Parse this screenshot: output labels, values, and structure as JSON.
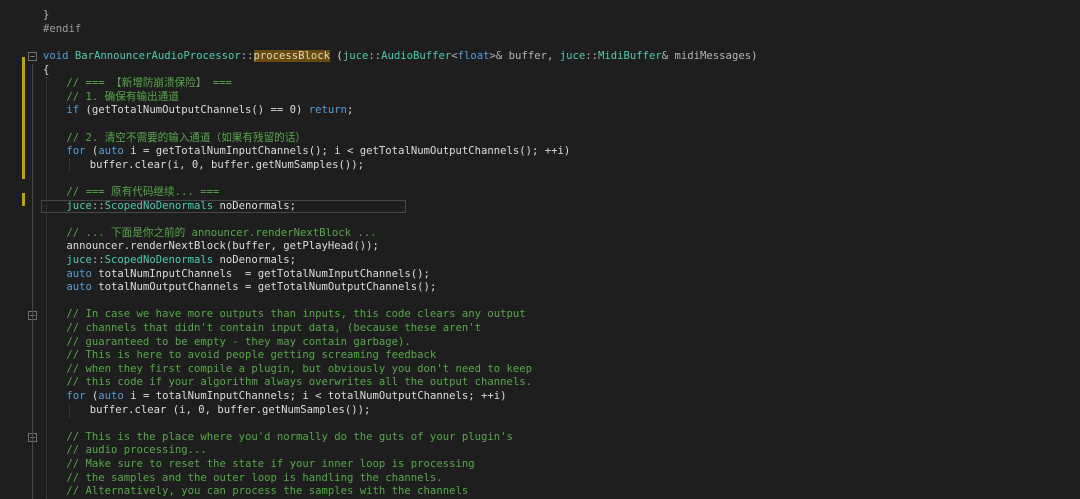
{
  "editor": {
    "lines": [
      {
        "row": 1,
        "indent": 0,
        "tokens": [
          {
            "t": "}",
            "c": "op"
          }
        ]
      },
      {
        "row": 2,
        "indent": 0,
        "tokens": [
          {
            "t": "#endif",
            "c": "pp"
          }
        ]
      },
      {
        "row": 4,
        "indent": 0,
        "tokens": [
          {
            "t": "void",
            "c": "kw"
          },
          {
            "t": " "
          },
          {
            "t": "BarAnnouncerAudioProcessor",
            "c": "ty"
          },
          {
            "t": "::",
            "c": "op"
          },
          {
            "t": "processBlock",
            "c": "hl"
          },
          {
            "t": " ("
          },
          {
            "t": "juce",
            "c": "ty"
          },
          {
            "t": "::",
            "c": "op"
          },
          {
            "t": "AudioBuffer",
            "c": "ty"
          },
          {
            "t": "<",
            "c": "op"
          },
          {
            "t": "float",
            "c": "kw"
          },
          {
            "t": ">& buffer, ",
            "c": "op"
          },
          {
            "t": "juce",
            "c": "ty"
          },
          {
            "t": "::",
            "c": "op"
          },
          {
            "t": "MidiBuffer",
            "c": "ty"
          },
          {
            "t": "& midiMessages)",
            "c": "op"
          }
        ]
      },
      {
        "row": 5,
        "indent": 0,
        "tokens": [
          {
            "t": "{"
          }
        ]
      },
      {
        "row": 6,
        "indent": 1,
        "tokens": [
          {
            "t": "// === 【新增防崩溃保险】 ===",
            "c": "cm"
          }
        ]
      },
      {
        "row": 7,
        "indent": 1,
        "tokens": [
          {
            "t": "// 1. 确保有输出通道",
            "c": "cm"
          }
        ]
      },
      {
        "row": 8,
        "indent": 1,
        "tokens": [
          {
            "t": "if",
            "c": "kw"
          },
          {
            "t": " (getTotalNumOutputChannels() == 0) "
          },
          {
            "t": "return",
            "c": "kw"
          },
          {
            "t": ";"
          }
        ]
      },
      {
        "row": 10,
        "indent": 1,
        "tokens": [
          {
            "t": "// 2. 清空不需要的输入通道（如果有残留的话）",
            "c": "cm"
          }
        ]
      },
      {
        "row": 11,
        "indent": 1,
        "tokens": [
          {
            "t": "for",
            "c": "kw"
          },
          {
            "t": " ("
          },
          {
            "t": "auto",
            "c": "kw"
          },
          {
            "t": " i = getTotalNumInputChannels(); i < getTotalNumOutputChannels(); ++i)"
          }
        ]
      },
      {
        "row": 12,
        "indent": 2,
        "tokens": [
          {
            "t": "buffer.clear(i, 0, buffer.getNumSamples());"
          }
        ]
      },
      {
        "row": 14,
        "indent": 1,
        "tokens": [
          {
            "t": "// === 原有代码继续... ===",
            "c": "cm"
          }
        ]
      },
      {
        "row": 15,
        "indent": 1,
        "current": true,
        "tokens": [
          {
            "t": "juce",
            "c": "ty"
          },
          {
            "t": "::",
            "c": "op"
          },
          {
            "t": "ScopedNoDenormals",
            "c": "ty"
          },
          {
            "t": " noDenormals;"
          }
        ]
      },
      {
        "row": 17,
        "indent": 1,
        "tokens": [
          {
            "t": "// ... 下面是你之前的 announcer.renderNextBlock ...",
            "c": "cm"
          }
        ]
      },
      {
        "row": 18,
        "indent": 1,
        "tokens": [
          {
            "t": "announcer.renderNextBlock(buffer, getPlayHead());"
          }
        ]
      },
      {
        "row": 19,
        "indent": 1,
        "tokens": [
          {
            "t": "juce",
            "c": "ty"
          },
          {
            "t": "::",
            "c": "op"
          },
          {
            "t": "ScopedNoDenormals",
            "c": "ty"
          },
          {
            "t": " noDenormals;"
          }
        ]
      },
      {
        "row": 20,
        "indent": 1,
        "tokens": [
          {
            "t": "auto",
            "c": "kw"
          },
          {
            "t": " totalNumInputChannels  = getTotalNumInputChannels();"
          }
        ]
      },
      {
        "row": 21,
        "indent": 1,
        "tokens": [
          {
            "t": "auto",
            "c": "kw"
          },
          {
            "t": " totalNumOutputChannels = getTotalNumOutputChannels();"
          }
        ]
      },
      {
        "row": 23,
        "indent": 1,
        "tokens": [
          {
            "t": "// In case we have more outputs than inputs, this code clears any output",
            "c": "cm"
          }
        ]
      },
      {
        "row": 24,
        "indent": 1,
        "tokens": [
          {
            "t": "// channels that didn't contain input data, (because these aren't",
            "c": "cm"
          }
        ]
      },
      {
        "row": 25,
        "indent": 1,
        "tokens": [
          {
            "t": "// guaranteed to be empty - they may contain garbage).",
            "c": "cm"
          }
        ]
      },
      {
        "row": 26,
        "indent": 1,
        "tokens": [
          {
            "t": "// This is here to avoid people getting screaming feedback",
            "c": "cm"
          }
        ]
      },
      {
        "row": 27,
        "indent": 1,
        "tokens": [
          {
            "t": "// when they first compile a plugin, but obviously you don't need to keep",
            "c": "cm"
          }
        ]
      },
      {
        "row": 28,
        "indent": 1,
        "tokens": [
          {
            "t": "// this code if your algorithm always overwrites all the output channels.",
            "c": "cm"
          }
        ]
      },
      {
        "row": 29,
        "indent": 1,
        "tokens": [
          {
            "t": "for",
            "c": "kw"
          },
          {
            "t": " ("
          },
          {
            "t": "auto",
            "c": "kw"
          },
          {
            "t": " i = totalNumInputChannels; i < totalNumOutputChannels; ++i)"
          }
        ]
      },
      {
        "row": 30,
        "indent": 2,
        "tokens": [
          {
            "t": "buffer.clear (i, 0, buffer.getNumSamples());"
          }
        ]
      },
      {
        "row": 32,
        "indent": 1,
        "tokens": [
          {
            "t": "// This is the place where you'd normally do the guts of your plugin's",
            "c": "cm"
          }
        ]
      },
      {
        "row": 33,
        "indent": 1,
        "tokens": [
          {
            "t": "// audio processing...",
            "c": "cm"
          }
        ]
      },
      {
        "row": 34,
        "indent": 1,
        "tokens": [
          {
            "t": "// Make sure to reset the state if your inner loop is processing",
            "c": "cm"
          }
        ]
      },
      {
        "row": 35,
        "indent": 1,
        "tokens": [
          {
            "t": "// the samples and the outer loop is handling the channels.",
            "c": "cm"
          }
        ]
      },
      {
        "row": 36,
        "indent": 1,
        "tokens": [
          {
            "t": "// Alternatively, you can process the samples with the channels",
            "c": "cm"
          }
        ]
      }
    ]
  }
}
